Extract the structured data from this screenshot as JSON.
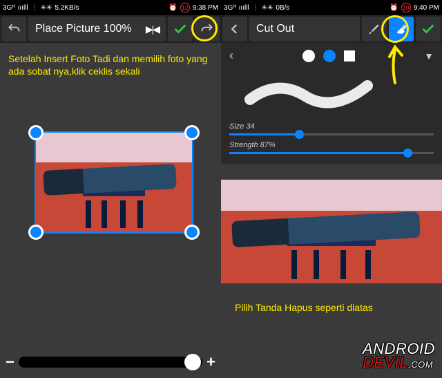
{
  "left": {
    "status": {
      "net": "3Gᴴ",
      "signal": "ııılll",
      "speed": "5.2KB/s",
      "batt": "12",
      "time": "9:38 PM"
    },
    "toolbar": {
      "title": "Place Picture 100%"
    },
    "instruction": "Setelah Insert Foto Tadi dan memilih foto yang ada sobat nya,klik ceklis sekali"
  },
  "right": {
    "status": {
      "net": "3Gᴴ",
      "signal": "ııılll",
      "speed": "0B/s",
      "batt": "10",
      "time": "9:40 PM"
    },
    "toolbar": {
      "title": "Cut Out"
    },
    "size_label": "Size 34",
    "size_pct": 34,
    "strength_label": "Strength 87%",
    "strength_pct": 87,
    "instruction": "Pilih Tanda Hapus seperti diatas"
  },
  "chart_data": {
    "type": "table",
    "title": "Brush settings (Cut Out tool)",
    "rows": [
      {
        "param": "Size",
        "value": 34,
        "range": [
          0,
          100
        ]
      },
      {
        "param": "Strength",
        "value": 87,
        "range": [
          0,
          100
        ]
      }
    ]
  },
  "watermark": {
    "line1": "ANDROID",
    "line2": "DEVIL",
    "suffix": ".COM"
  }
}
